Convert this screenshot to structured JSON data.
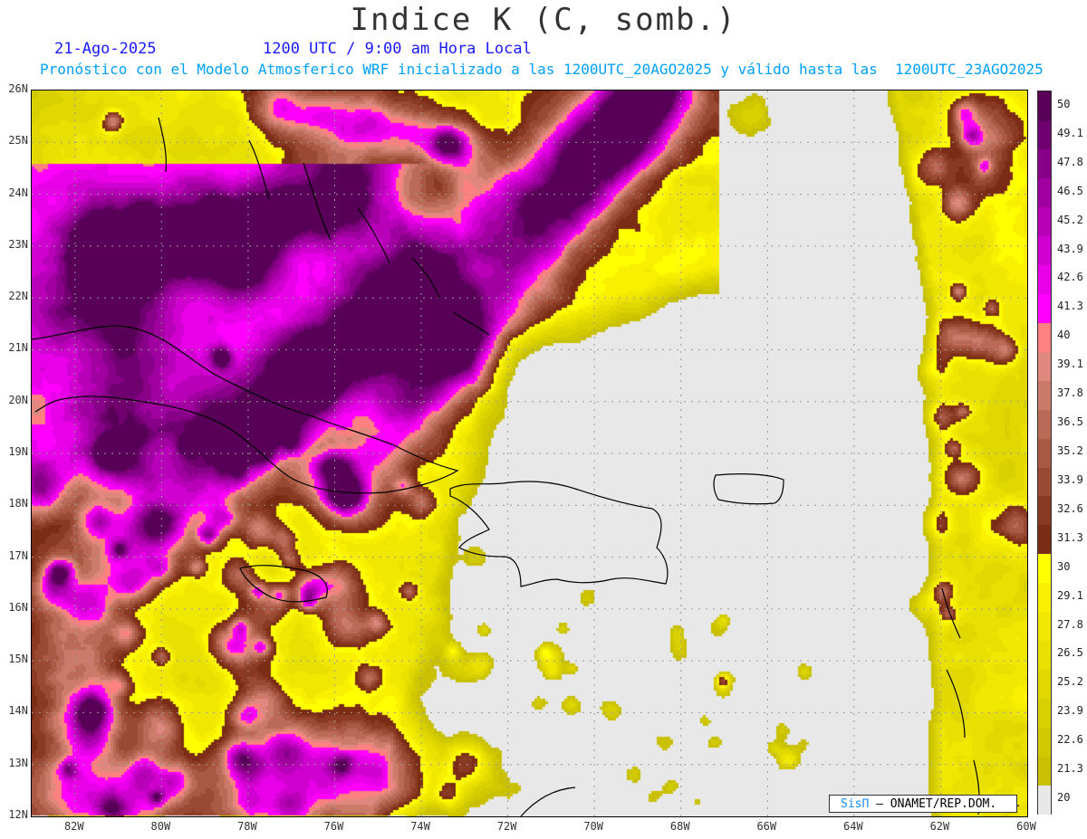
{
  "header": {
    "title": "Indice K (C, somb.)",
    "date": "21-Ago-2025",
    "valid_time": "1200 UTC / 9:00 am Hora Local",
    "forecast_text": "Pronóstico con el Modelo Atmosferico WRF inicializado a las 1200UTC_20AGO2025 y válido hasta las  1200UTC_23AGO2025"
  },
  "credit": {
    "brand": "SisΠ",
    "text": "– ONAMET/REP.DOM."
  },
  "chart_data": {
    "type": "heatmap",
    "title": "Indice K (C, somb.)",
    "xlabel": "",
    "ylabel": "",
    "xlim": [
      -83,
      -60
    ],
    "ylim": [
      12,
      26
    ],
    "lat_ticks": [
      "26N",
      "25N",
      "24N",
      "23N",
      "22N",
      "21N",
      "20N",
      "19N",
      "18N",
      "17N",
      "16N",
      "15N",
      "14N",
      "13N",
      "12N"
    ],
    "lon_ticks": [
      "82W",
      "80W",
      "78W",
      "76W",
      "74W",
      "72W",
      "70W",
      "68W",
      "66W",
      "64W",
      "62W",
      "60W"
    ],
    "grid": true,
    "colorbar": {
      "units": "C",
      "levels": [
        20,
        21.3,
        22.6,
        23.9,
        25.2,
        26.5,
        27.8,
        29.1,
        30,
        31.3,
        32.6,
        33.9,
        35.2,
        36.5,
        37.8,
        39.1,
        40,
        41.3,
        42.6,
        43.9,
        45.2,
        46.5,
        47.8,
        49.1,
        50
      ],
      "level_labels": [
        "20",
        "21.3",
        "22.6",
        "23.9",
        "25.2",
        "26.5",
        "27.8",
        "29.1",
        "30",
        "31.3",
        "32.6",
        "33.9",
        "35.2",
        "36.5",
        "37.8",
        "39.1",
        "40",
        "41.3",
        "42.6",
        "43.9",
        "45.2",
        "46.5",
        "47.8",
        "49.1",
        "50"
      ],
      "colors": [
        "#e8e8e8",
        "#c8c000",
        "#d0c800",
        "#d8d000",
        "#e0d800",
        "#e8e000",
        "#f0e800",
        "#f8f000",
        "#ffff00",
        "#7a2c14",
        "#8a3a22",
        "#9a4a32",
        "#aa5a44",
        "#ba6a56",
        "#cc7a6a",
        "#e08880",
        "#ff8080",
        "#ff00ff",
        "#e800e8",
        "#d000d0",
        "#b800b8",
        "#a000a0",
        "#880088",
        "#700070",
        "#580058"
      ]
    }
  }
}
